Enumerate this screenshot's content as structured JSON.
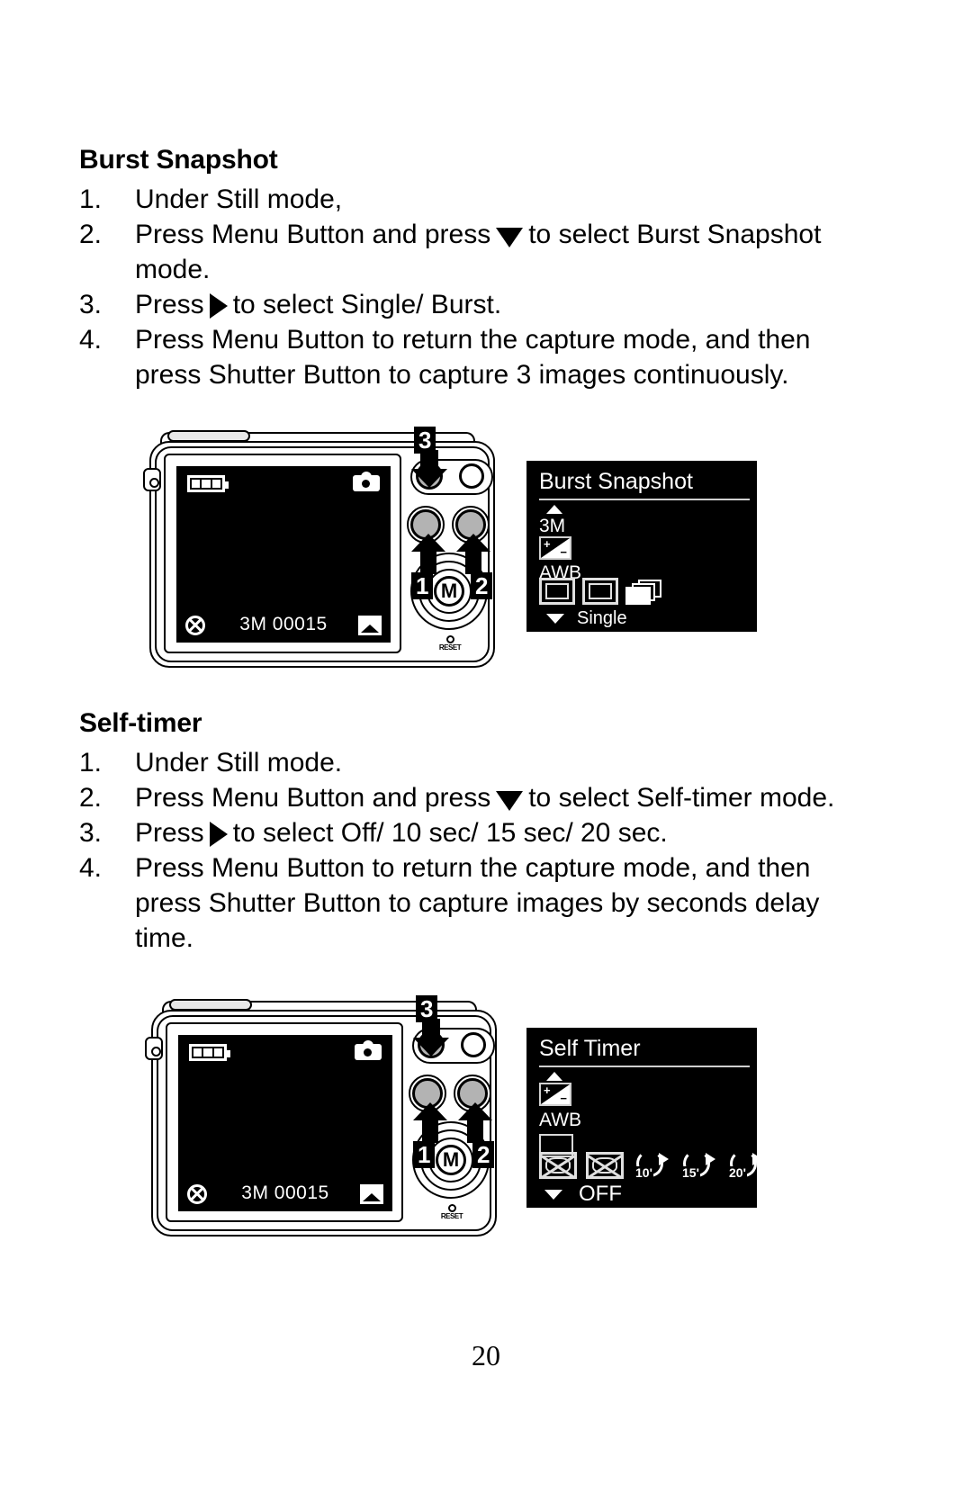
{
  "page": {
    "number": "20"
  },
  "sections": [
    {
      "id": "burst-snapshot",
      "heading": "Burst Snapshot",
      "steps": [
        {
          "num": "1.",
          "before": "Under Still mode,",
          "glyph": "",
          "after": ""
        },
        {
          "num": "2.",
          "before": "Press Menu Button and press",
          "glyph": "down-triangle",
          "after": "to select Burst Snapshot mode."
        },
        {
          "num": "3.",
          "before": "Press",
          "glyph": "right-triangle",
          "after": "to select Single/ Burst."
        },
        {
          "num": "4.",
          "before": "Press Menu Button to return the capture mode, and then press Shutter Button to capture 3 images continuously.",
          "glyph": "",
          "after": ""
        }
      ],
      "camera": {
        "lcd": {
          "status": "3M 00015"
        },
        "mode_dial_label": "M",
        "reset_label": "RESET",
        "callouts": [
          "3",
          "1",
          "2"
        ]
      },
      "menu": {
        "title": "Burst Snapshot",
        "rows": [
          "3M",
          "ev-icon",
          "AWB"
        ],
        "row_labels": {
          "resolution": "3M",
          "white_balance": "AWB"
        },
        "options": [
          "single-box-icon",
          "inner-box-icon",
          "burst-stack-icon"
        ],
        "selected_value": "Single"
      }
    },
    {
      "id": "self-timer",
      "heading": "Self-timer",
      "steps": [
        {
          "num": "1.",
          "before": "Under Still mode.",
          "glyph": "",
          "after": ""
        },
        {
          "num": "2.",
          "before": "Press Menu Button and press",
          "glyph": "down-triangle",
          "after": "to select Self-timer mode."
        },
        {
          "num": "3.",
          "before": "Press",
          "glyph": "right-triangle",
          "after": "to select Off/ 10 sec/ 15 sec/ 20 sec."
        },
        {
          "num": "4.",
          "before": "Press Menu Button to return the capture mode, and then press Shutter Button to capture images by seconds delay time.",
          "glyph": "",
          "after": ""
        }
      ],
      "camera": {
        "lcd": {
          "status": "3M 00015"
        },
        "mode_dial_label": "M",
        "reset_label": "RESET",
        "callouts": [
          "3",
          "1",
          "2"
        ]
      },
      "menu": {
        "title": "Self Timer",
        "rows": [
          "ev-icon",
          "AWB",
          "blank-box"
        ],
        "row_labels": {
          "white_balance": "AWB"
        },
        "timer_options": [
          "10'",
          "15'",
          "20'"
        ],
        "selected_value": "OFF"
      }
    }
  ]
}
